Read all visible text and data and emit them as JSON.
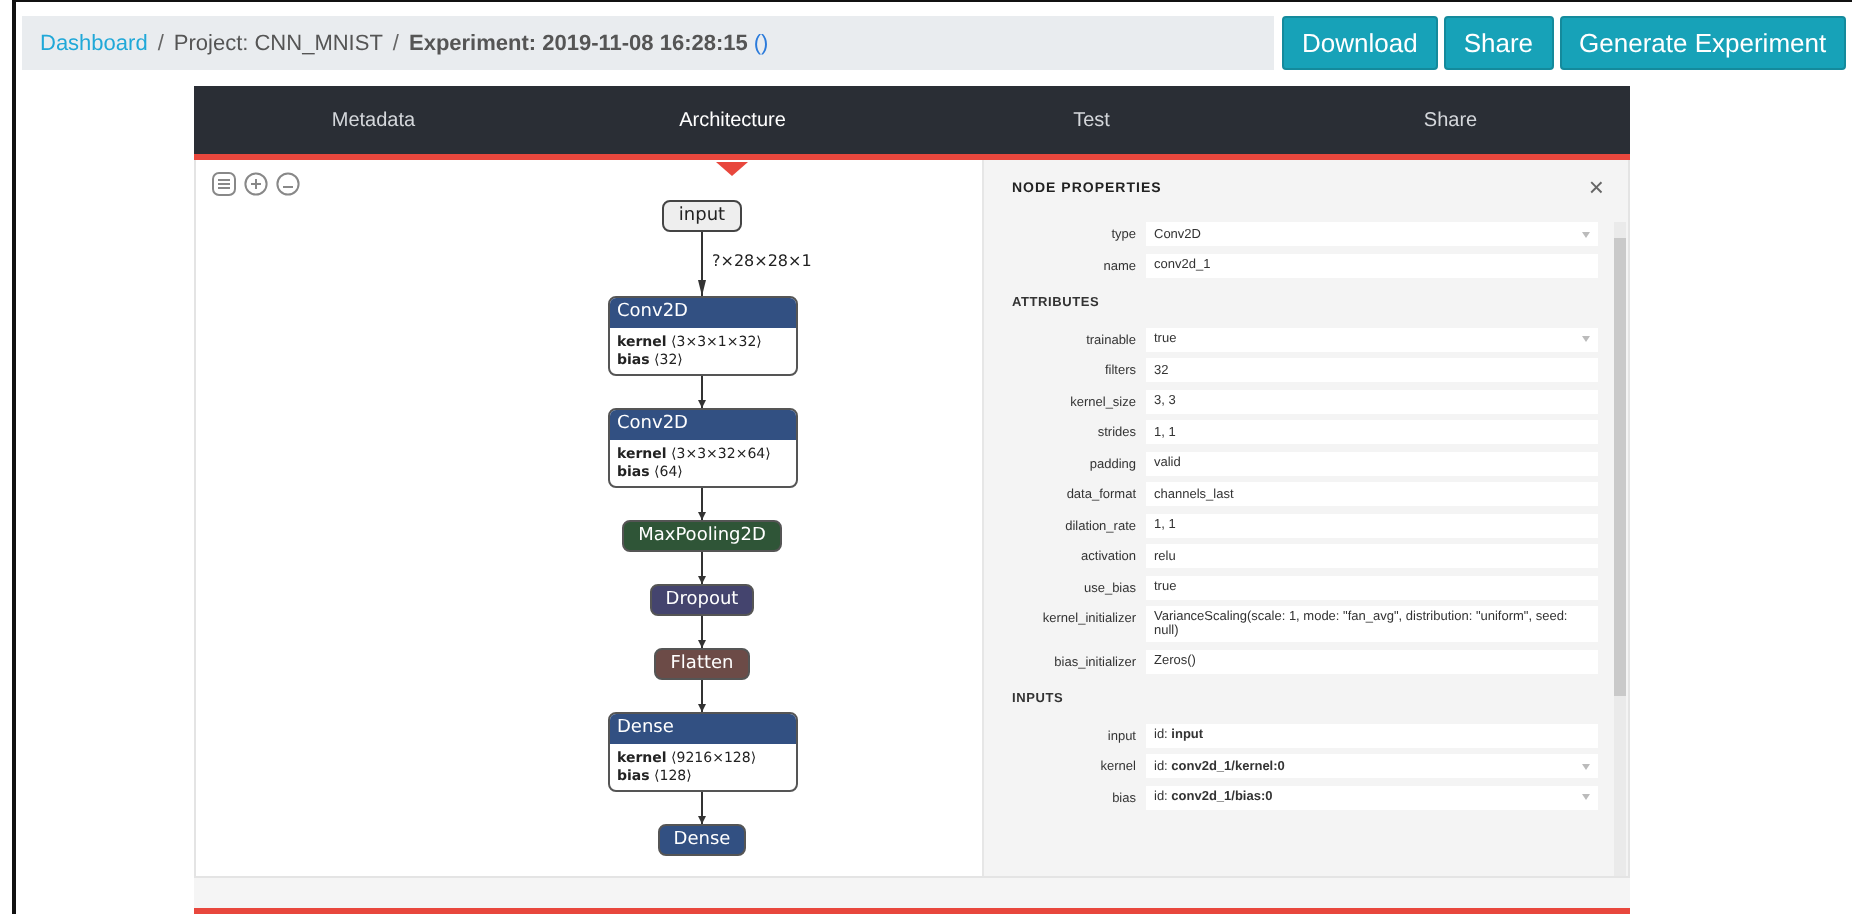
{
  "breadcrumb": [
    {
      "text": "Dashboard",
      "kind": "link"
    },
    {
      "text": "/",
      "kind": "separator"
    },
    {
      "text": "Project: CNN_MNIST",
      "kind": "plain"
    },
    {
      "text": "/",
      "kind": "separator"
    },
    {
      "text": "Experiment: 2019-11-08 16:28:15",
      "kind": "bold"
    },
    {
      "text": "()",
      "kind": "link"
    }
  ],
  "actions": [
    "Download",
    "Share",
    "Generate Experiment"
  ],
  "tabs": [
    {
      "label": "Metadata",
      "selected": false
    },
    {
      "label": "Architecture",
      "selected": true
    },
    {
      "label": "Test",
      "selected": false
    },
    {
      "label": "Share",
      "selected": false
    }
  ],
  "graph": {
    "nodes": [
      {
        "title": "input",
        "color": "#eeeeee",
        "edge_label": "?×28×28×1"
      },
      {
        "title": "Conv2D",
        "color": "#325082",
        "attributes": [
          {
            "name": "kernel",
            "value": "⟨3×3×1×32⟩"
          },
          {
            "name": "bias",
            "value": "⟨32⟩"
          }
        ]
      },
      {
        "title": "Conv2D",
        "color": "#325082",
        "attributes": [
          {
            "name": "kernel",
            "value": "⟨3×3×32×64⟩"
          },
          {
            "name": "bias",
            "value": "⟨64⟩"
          }
        ]
      },
      {
        "title": "MaxPooling2D",
        "color": "#2f5537"
      },
      {
        "title": "Dropout",
        "color": "#44446e"
      },
      {
        "title": "Flatten",
        "color": "#6c4b47"
      },
      {
        "title": "Dense",
        "color": "#325082",
        "attributes": [
          {
            "name": "kernel",
            "value": "⟨9216×128⟩"
          },
          {
            "name": "bias",
            "value": "⟨128⟩"
          }
        ]
      },
      {
        "title": "Dense",
        "color": "#325082"
      }
    ]
  },
  "properties": {
    "title": "NODE PROPERTIES",
    "close": "×",
    "sections": [
      {
        "rows": [
          {
            "label": "type",
            "value": "Conv2D",
            "dropdown": true
          },
          {
            "label": "name",
            "value": "conv2d_1",
            "dropdown": false
          }
        ]
      },
      {
        "heading": "ATTRIBUTES",
        "rows": [
          {
            "label": "trainable",
            "value": "true",
            "dropdown": true
          },
          {
            "label": "filters",
            "value": "32",
            "dropdown": false
          },
          {
            "label": "kernel_size",
            "value": "3, 3",
            "dropdown": false
          },
          {
            "label": "strides",
            "value": "1, 1",
            "dropdown": false
          },
          {
            "label": "padding",
            "value": "valid",
            "dropdown": false
          },
          {
            "label": "data_format",
            "value": "channels_last",
            "dropdown": false
          },
          {
            "label": "dilation_rate",
            "value": "1, 1",
            "dropdown": false
          },
          {
            "label": "activation",
            "value": "relu",
            "dropdown": false
          },
          {
            "label": "use_bias",
            "value": "true",
            "dropdown": false
          },
          {
            "label": "kernel_initializer",
            "value": "VarianceScaling(scale: 1, mode: \"fan_avg\", distribution: \"uniform\", seed: null)",
            "dropdown": false
          },
          {
            "label": "bias_initializer",
            "value": "Zeros()",
            "dropdown": false
          }
        ]
      },
      {
        "heading": "INPUTS",
        "rows": [
          {
            "label": "input",
            "value": "id: **input**",
            "dropdown": false
          },
          {
            "label": "kernel",
            "value": "id: **conv2d_1/kernel:0**",
            "dropdown": true
          },
          {
            "label": "bias",
            "value": "id: **conv2d_1/bias:0**",
            "dropdown": true
          }
        ]
      }
    ]
  }
}
